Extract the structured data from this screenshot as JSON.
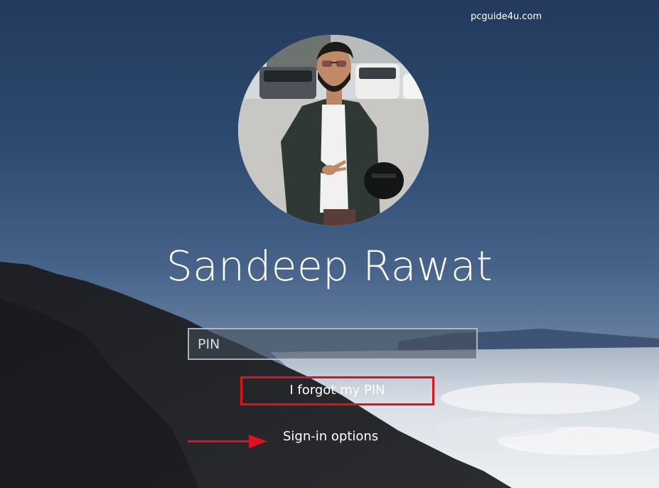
{
  "watermark": "pcguide4u.com",
  "user": {
    "name": "Sandeep Rawat",
    "avatar_icon": "user-photo"
  },
  "pin": {
    "placeholder": "PIN",
    "value": ""
  },
  "links": {
    "forgot_pin": "I forgot my PIN",
    "signin_options": "Sign-in options"
  },
  "annotations": {
    "highlight_color": "#e0111b",
    "arrow_color": "#e0111b"
  }
}
